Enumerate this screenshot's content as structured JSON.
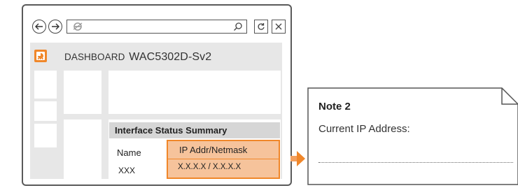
{
  "browser": {
    "nav": {
      "back_icon": "back-arrow-icon",
      "forward_icon": "forward-arrow-icon"
    },
    "url_bar": {
      "icon": "internet-explorer-icon",
      "search_icon": "search-icon"
    },
    "buttons": {
      "refresh_icon": "refresh-icon",
      "close_icon": "close-icon"
    }
  },
  "app": {
    "logo_icon": "dashboard-logo-icon",
    "section": "DASHBOARD",
    "model": "WAC5302D-Sv2"
  },
  "interface_status": {
    "title": "Interface Status Summary",
    "columns": [
      "Name",
      "IP Addr/Netmask"
    ],
    "rows": [
      {
        "name": "XXX",
        "ip": "X.X.X.X / X.X.X.X"
      }
    ]
  },
  "note": {
    "title": "Note 2",
    "text": "Current IP Address:"
  },
  "colors": {
    "accent": "#f0872a",
    "highlight_fill": "#f6c39b",
    "panel_bg": "#e7e7e7",
    "header_bg": "#d6d6d6"
  }
}
